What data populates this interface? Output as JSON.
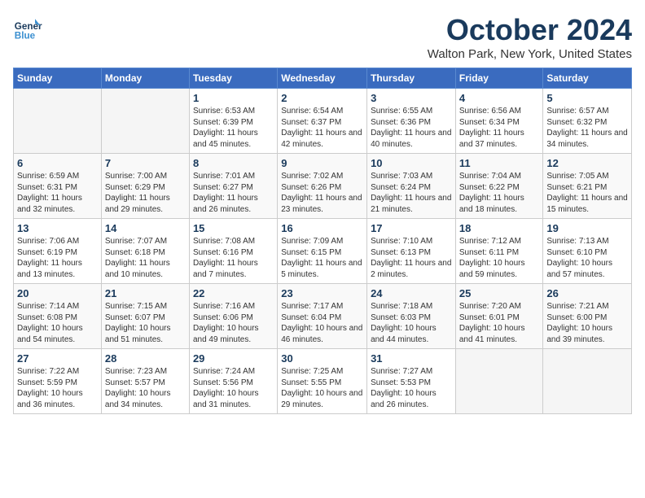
{
  "logo": {
    "name_line1": "General",
    "name_line2": "Blue"
  },
  "title": "October 2024",
  "location": "Walton Park, New York, United States",
  "weekdays": [
    "Sunday",
    "Monday",
    "Tuesday",
    "Wednesday",
    "Thursday",
    "Friday",
    "Saturday"
  ],
  "weeks": [
    [
      {
        "day": "",
        "sunrise": "",
        "sunset": "",
        "daylight": "",
        "empty": true
      },
      {
        "day": "",
        "sunrise": "",
        "sunset": "",
        "daylight": "",
        "empty": true
      },
      {
        "day": "1",
        "sunrise": "Sunrise: 6:53 AM",
        "sunset": "Sunset: 6:39 PM",
        "daylight": "Daylight: 11 hours and 45 minutes.",
        "empty": false
      },
      {
        "day": "2",
        "sunrise": "Sunrise: 6:54 AM",
        "sunset": "Sunset: 6:37 PM",
        "daylight": "Daylight: 11 hours and 42 minutes.",
        "empty": false
      },
      {
        "day": "3",
        "sunrise": "Sunrise: 6:55 AM",
        "sunset": "Sunset: 6:36 PM",
        "daylight": "Daylight: 11 hours and 40 minutes.",
        "empty": false
      },
      {
        "day": "4",
        "sunrise": "Sunrise: 6:56 AM",
        "sunset": "Sunset: 6:34 PM",
        "daylight": "Daylight: 11 hours and 37 minutes.",
        "empty": false
      },
      {
        "day": "5",
        "sunrise": "Sunrise: 6:57 AM",
        "sunset": "Sunset: 6:32 PM",
        "daylight": "Daylight: 11 hours and 34 minutes.",
        "empty": false
      }
    ],
    [
      {
        "day": "6",
        "sunrise": "Sunrise: 6:59 AM",
        "sunset": "Sunset: 6:31 PM",
        "daylight": "Daylight: 11 hours and 32 minutes.",
        "empty": false
      },
      {
        "day": "7",
        "sunrise": "Sunrise: 7:00 AM",
        "sunset": "Sunset: 6:29 PM",
        "daylight": "Daylight: 11 hours and 29 minutes.",
        "empty": false
      },
      {
        "day": "8",
        "sunrise": "Sunrise: 7:01 AM",
        "sunset": "Sunset: 6:27 PM",
        "daylight": "Daylight: 11 hours and 26 minutes.",
        "empty": false
      },
      {
        "day": "9",
        "sunrise": "Sunrise: 7:02 AM",
        "sunset": "Sunset: 6:26 PM",
        "daylight": "Daylight: 11 hours and 23 minutes.",
        "empty": false
      },
      {
        "day": "10",
        "sunrise": "Sunrise: 7:03 AM",
        "sunset": "Sunset: 6:24 PM",
        "daylight": "Daylight: 11 hours and 21 minutes.",
        "empty": false
      },
      {
        "day": "11",
        "sunrise": "Sunrise: 7:04 AM",
        "sunset": "Sunset: 6:22 PM",
        "daylight": "Daylight: 11 hours and 18 minutes.",
        "empty": false
      },
      {
        "day": "12",
        "sunrise": "Sunrise: 7:05 AM",
        "sunset": "Sunset: 6:21 PM",
        "daylight": "Daylight: 11 hours and 15 minutes.",
        "empty": false
      }
    ],
    [
      {
        "day": "13",
        "sunrise": "Sunrise: 7:06 AM",
        "sunset": "Sunset: 6:19 PM",
        "daylight": "Daylight: 11 hours and 13 minutes.",
        "empty": false
      },
      {
        "day": "14",
        "sunrise": "Sunrise: 7:07 AM",
        "sunset": "Sunset: 6:18 PM",
        "daylight": "Daylight: 11 hours and 10 minutes.",
        "empty": false
      },
      {
        "day": "15",
        "sunrise": "Sunrise: 7:08 AM",
        "sunset": "Sunset: 6:16 PM",
        "daylight": "Daylight: 11 hours and 7 minutes.",
        "empty": false
      },
      {
        "day": "16",
        "sunrise": "Sunrise: 7:09 AM",
        "sunset": "Sunset: 6:15 PM",
        "daylight": "Daylight: 11 hours and 5 minutes.",
        "empty": false
      },
      {
        "day": "17",
        "sunrise": "Sunrise: 7:10 AM",
        "sunset": "Sunset: 6:13 PM",
        "daylight": "Daylight: 11 hours and 2 minutes.",
        "empty": false
      },
      {
        "day": "18",
        "sunrise": "Sunrise: 7:12 AM",
        "sunset": "Sunset: 6:11 PM",
        "daylight": "Daylight: 10 hours and 59 minutes.",
        "empty": false
      },
      {
        "day": "19",
        "sunrise": "Sunrise: 7:13 AM",
        "sunset": "Sunset: 6:10 PM",
        "daylight": "Daylight: 10 hours and 57 minutes.",
        "empty": false
      }
    ],
    [
      {
        "day": "20",
        "sunrise": "Sunrise: 7:14 AM",
        "sunset": "Sunset: 6:08 PM",
        "daylight": "Daylight: 10 hours and 54 minutes.",
        "empty": false
      },
      {
        "day": "21",
        "sunrise": "Sunrise: 7:15 AM",
        "sunset": "Sunset: 6:07 PM",
        "daylight": "Daylight: 10 hours and 51 minutes.",
        "empty": false
      },
      {
        "day": "22",
        "sunrise": "Sunrise: 7:16 AM",
        "sunset": "Sunset: 6:06 PM",
        "daylight": "Daylight: 10 hours and 49 minutes.",
        "empty": false
      },
      {
        "day": "23",
        "sunrise": "Sunrise: 7:17 AM",
        "sunset": "Sunset: 6:04 PM",
        "daylight": "Daylight: 10 hours and 46 minutes.",
        "empty": false
      },
      {
        "day": "24",
        "sunrise": "Sunrise: 7:18 AM",
        "sunset": "Sunset: 6:03 PM",
        "daylight": "Daylight: 10 hours and 44 minutes.",
        "empty": false
      },
      {
        "day": "25",
        "sunrise": "Sunrise: 7:20 AM",
        "sunset": "Sunset: 6:01 PM",
        "daylight": "Daylight: 10 hours and 41 minutes.",
        "empty": false
      },
      {
        "day": "26",
        "sunrise": "Sunrise: 7:21 AM",
        "sunset": "Sunset: 6:00 PM",
        "daylight": "Daylight: 10 hours and 39 minutes.",
        "empty": false
      }
    ],
    [
      {
        "day": "27",
        "sunrise": "Sunrise: 7:22 AM",
        "sunset": "Sunset: 5:59 PM",
        "daylight": "Daylight: 10 hours and 36 minutes.",
        "empty": false
      },
      {
        "day": "28",
        "sunrise": "Sunrise: 7:23 AM",
        "sunset": "Sunset: 5:57 PM",
        "daylight": "Daylight: 10 hours and 34 minutes.",
        "empty": false
      },
      {
        "day": "29",
        "sunrise": "Sunrise: 7:24 AM",
        "sunset": "Sunset: 5:56 PM",
        "daylight": "Daylight: 10 hours and 31 minutes.",
        "empty": false
      },
      {
        "day": "30",
        "sunrise": "Sunrise: 7:25 AM",
        "sunset": "Sunset: 5:55 PM",
        "daylight": "Daylight: 10 hours and 29 minutes.",
        "empty": false
      },
      {
        "day": "31",
        "sunrise": "Sunrise: 7:27 AM",
        "sunset": "Sunset: 5:53 PM",
        "daylight": "Daylight: 10 hours and 26 minutes.",
        "empty": false
      },
      {
        "day": "",
        "sunrise": "",
        "sunset": "",
        "daylight": "",
        "empty": true
      },
      {
        "day": "",
        "sunrise": "",
        "sunset": "",
        "daylight": "",
        "empty": true
      }
    ]
  ]
}
